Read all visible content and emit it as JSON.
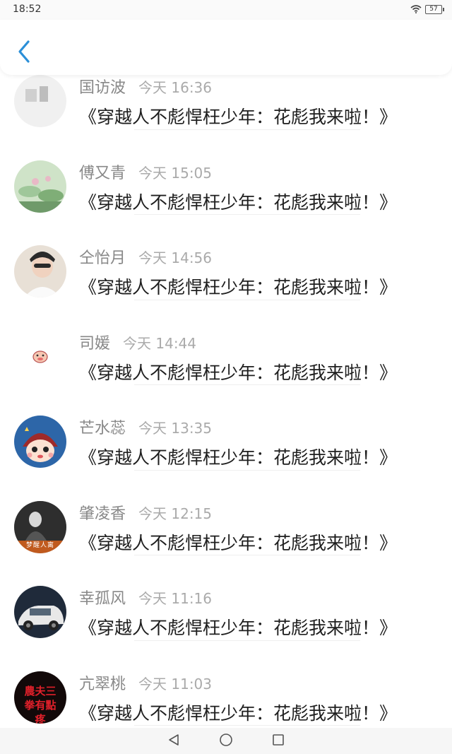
{
  "status_bar": {
    "time": "18:52",
    "battery": "57"
  },
  "header": {
    "back_icon": "chevron-left-icon",
    "accent": "#2b8fd8"
  },
  "messages": [
    {
      "name": "国访波",
      "time": "今天 16:36",
      "text": "《穿越人不彪悍枉少年：花彪我来啦！》",
      "avatar_colors": [
        "#f0f0f0",
        "#cfcfcf"
      ]
    },
    {
      "name": "傅又青",
      "time": "今天 15:05",
      "text": "《穿越人不彪悍枉少年：花彪我来啦！》",
      "avatar_colors": [
        "#9fc79a",
        "#e8b9c6"
      ]
    },
    {
      "name": "仝怡月",
      "time": "今天 14:56",
      "text": "《穿越人不彪悍枉少年：花彪我来啦！》",
      "avatar_colors": [
        "#e8e0d6",
        "#2a2a2a"
      ]
    },
    {
      "name": "司媛",
      "time": "今天 14:44",
      "text": "《穿越人不彪悍枉少年：花彪我来啦！》",
      "avatar_colors": [
        "#ffffff",
        "#e66a6a"
      ]
    },
    {
      "name": "芒水蕊",
      "time": "今天 13:35",
      "text": "《穿越人不彪悍枉少年：花彪我来啦！》",
      "avatar_colors": [
        "#2d66a8",
        "#9e2a2a"
      ]
    },
    {
      "name": "肇凌香",
      "time": "今天 12:15",
      "text": "《穿越人不彪悍枉少年：花彪我来啦！》",
      "avatar_colors": [
        "#2e2e2e",
        "#c05a1e"
      ],
      "avatar_text": "梦醒人离"
    },
    {
      "name": "幸孤风",
      "time": "今天 11:16",
      "text": "《穿越人不彪悍枉少年：花彪我来啦！》",
      "avatar_colors": [
        "#1f2a3a",
        "#e8e8e8"
      ]
    },
    {
      "name": "亢翠桃",
      "time": "今天 11:03",
      "text": "《穿越人不彪悍枉少年：花彪我来啦！》",
      "avatar_colors": [
        "#120909",
        "#e0202a"
      ],
      "avatar_text": "農夫三拳有點疼"
    }
  ],
  "nav_bar": {
    "icons": [
      "back-triangle-icon",
      "home-circle-icon",
      "recents-square-icon"
    ]
  }
}
